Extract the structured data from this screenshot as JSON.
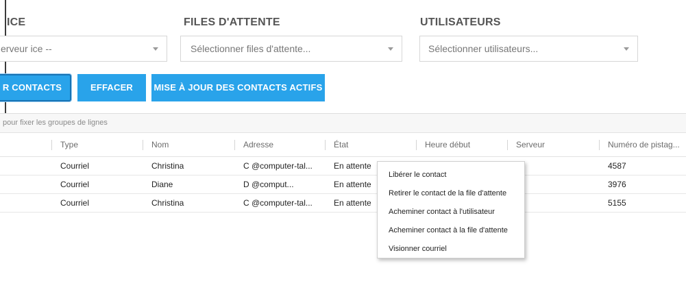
{
  "filters": {
    "service_label": "ICE",
    "service_value": "erveur ice --",
    "queues_label": "FILES D'ATTENTE",
    "queues_placeholder": "Sélectionner files d'attente...",
    "users_label": "UTILISATEURS",
    "users_placeholder": "Sélectionner utilisateurs..."
  },
  "toolbar": {
    "contacts_label": "R CONTACTS",
    "clear_label": "EFFACER",
    "update_label": "MISE À JOUR DES CONTACTS ACTIFS"
  },
  "grid": {
    "group_hint": "pour fixer les groupes de lignes",
    "columns": [
      "Type",
      "Nom",
      "Adresse",
      "État",
      "Heure début",
      "Serveur",
      "Numéro de pistag..."
    ],
    "rows": [
      {
        "type": "Courriel",
        "name": "Christina",
        "address": "C @computer-tal...",
        "state": "En attente",
        "tracking": "4587"
      },
      {
        "type": "Courriel",
        "name": "Diane",
        "address": "D @comput...",
        "state": "En attente",
        "tracking": "3976"
      },
      {
        "type": "Courriel",
        "name": "Christina",
        "address": "C @computer-tal...",
        "state": "En attente",
        "tracking": "5155"
      }
    ]
  },
  "context_menu": {
    "items": [
      "Libérer le contact",
      "Retirer le contact de la file d'attente",
      "Acheminer contact à l'utilisateur",
      "Acheminer contact à la file d'attente",
      "Visionner courriel"
    ]
  },
  "colors": {
    "button_blue": "#29a3ea",
    "button_border": "#1873b4"
  },
  "icons": {
    "select_caret": "chevron-down-icon"
  }
}
